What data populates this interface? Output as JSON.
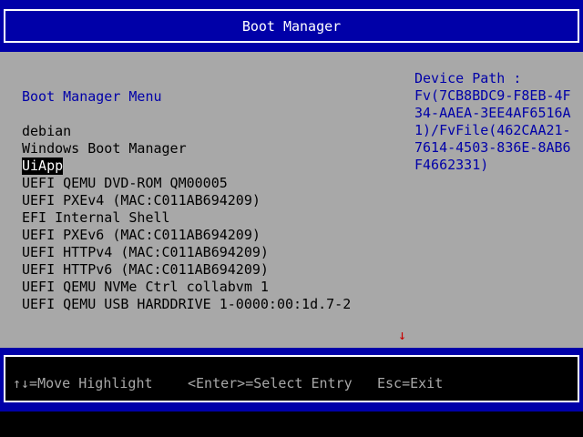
{
  "header": {
    "title": "Boot Manager"
  },
  "menu": {
    "heading": "Boot Manager Menu",
    "selected_index": 2,
    "entries": [
      "debian",
      "Windows Boot Manager",
      "UiApp",
      "UEFI QEMU DVD-ROM QM00005",
      "UEFI PXEv4 (MAC:C011AB694209)",
      "EFI Internal Shell",
      "UEFI PXEv6 (MAC:C011AB694209)",
      "UEFI HTTPv4 (MAC:C011AB694209)",
      "UEFI HTTPv6 (MAC:C011AB694209)",
      "UEFI QEMU NVMe Ctrl collabvm 1",
      "UEFI QEMU USB HARDDRIVE 1-0000:00:1d.7-2"
    ]
  },
  "device_path": {
    "label": "Device Path :",
    "value": "Fv(7CB8BDC9-F8EB-4F34-AAEA-3EE4AF6516A1)/FvFile(462CAA21-7614-4503-836E-8AB6F4662331)"
  },
  "scroll_indicator": "↓",
  "footer": {
    "move_highlight": "↑↓=Move Highlight",
    "select_entry": "<Enter>=Select Entry",
    "exit": "Esc=Exit"
  },
  "colors": {
    "frame_blue": "#0000a8",
    "panel_gray": "#a8a8a8",
    "heading_blue": "#0000a8",
    "scroll_arrow_red": "#c80000"
  }
}
